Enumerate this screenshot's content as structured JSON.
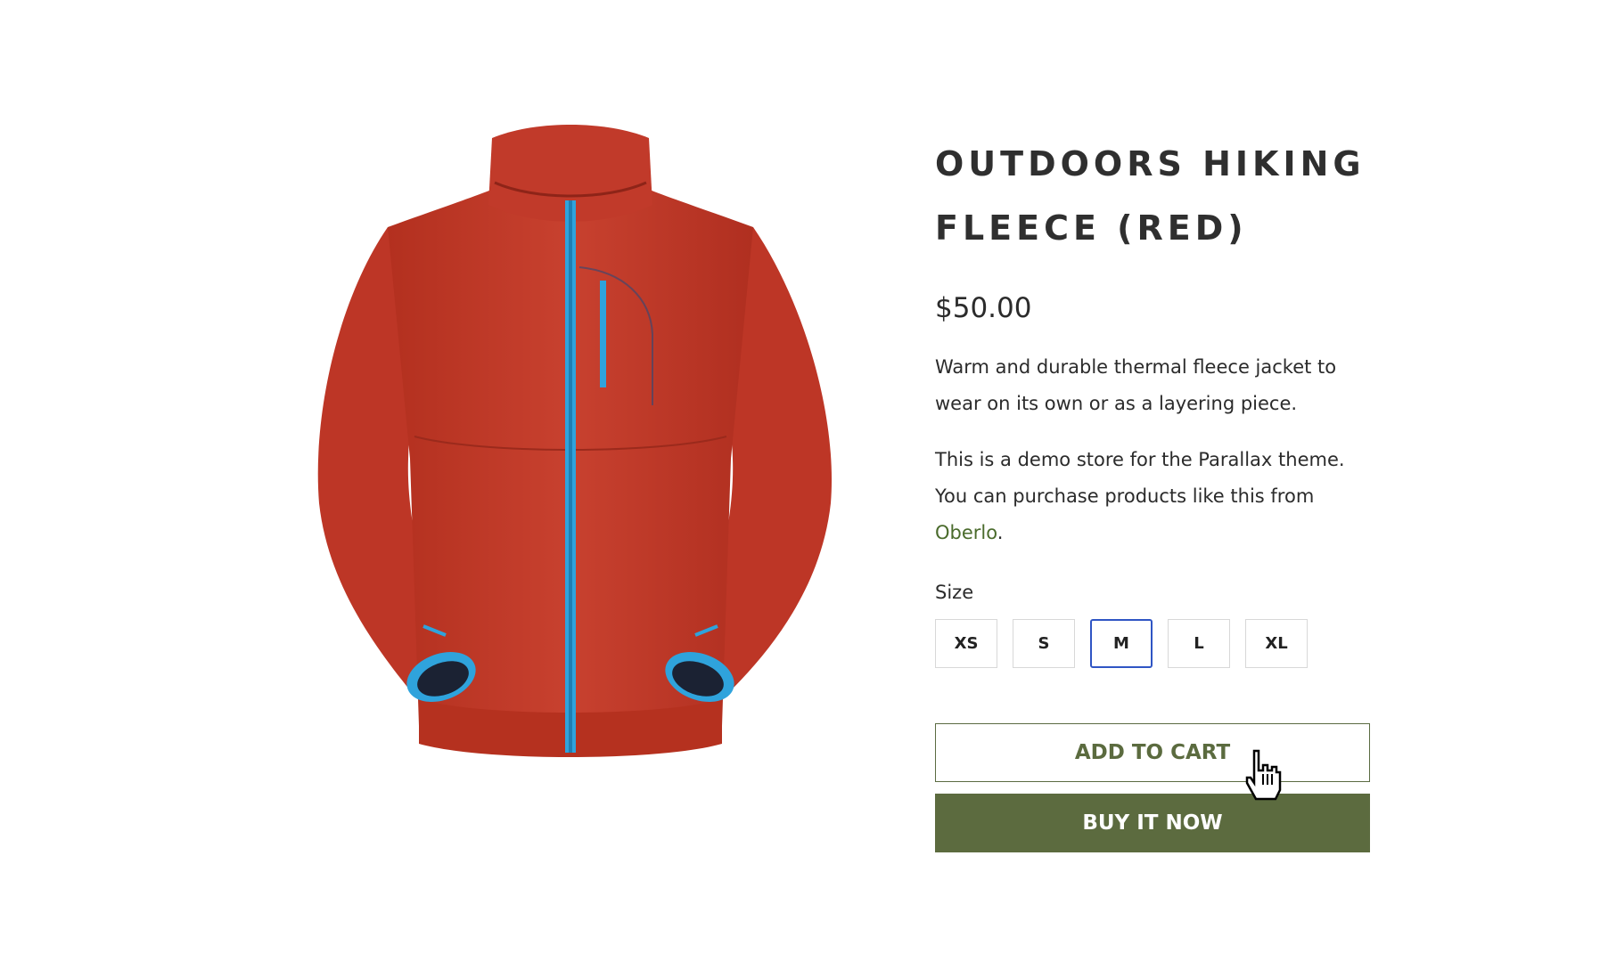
{
  "product": {
    "title": "OUTDOORS HIKING FLEECE (RED)",
    "price": "$50.00",
    "description": "Warm and durable thermal fleece jacket to wear on its own or as a layering piece.",
    "demo_text_prefix": "This is a demo store for the Parallax theme. You can purchase products like this from ",
    "demo_link": "Oberlo",
    "demo_text_suffix": "."
  },
  "size": {
    "label": "Size",
    "options": [
      "XS",
      "S",
      "M",
      "L",
      "XL"
    ],
    "selected": "M"
  },
  "actions": {
    "add_to_cart": "ADD TO CART",
    "buy_now": "BUY IT NOW"
  },
  "colors": {
    "accent_green": "#5c6b3f",
    "selected_border": "#2f55c4",
    "jacket_red": "#c4392b",
    "zipper_blue": "#2fa3dc"
  }
}
